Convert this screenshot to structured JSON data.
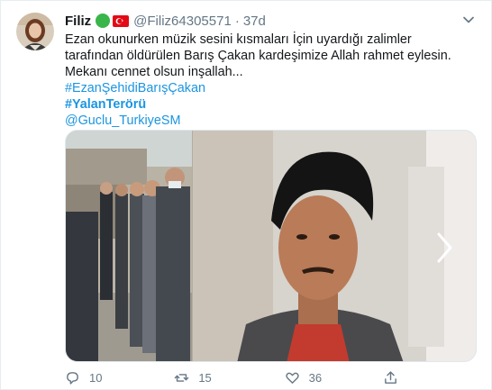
{
  "user": {
    "name": "Filiz",
    "handle": "@Filiz64305571",
    "separator": "·",
    "time": "37d"
  },
  "tweet": {
    "text_line1": "Ezan okunurken müzik sesini kısmaları İçin uyardığı zalimler tarafından öldürülen Barış Çakan kardeşimize Allah rahmet eylesin. Mekanı cennet olsun inşallah...",
    "hashtag1": "#EzanŞehidiBarışÇakan",
    "hashtag2": "#YalanTerörü",
    "mention": "@Guclu_TurkiyeSM"
  },
  "counts": {
    "replies": "10",
    "retweets": "15",
    "likes": "36"
  },
  "colors": {
    "link": "#1b95e0",
    "muted": "#657786",
    "badge": "#3ab54a",
    "flag": "#e30a17"
  },
  "icons": [
    "verified-green-circle-icon",
    "turkey-flag-icon",
    "chevron-down-icon",
    "reply-icon",
    "retweet-icon",
    "like-icon",
    "share-icon",
    "next-arrow-icon"
  ]
}
